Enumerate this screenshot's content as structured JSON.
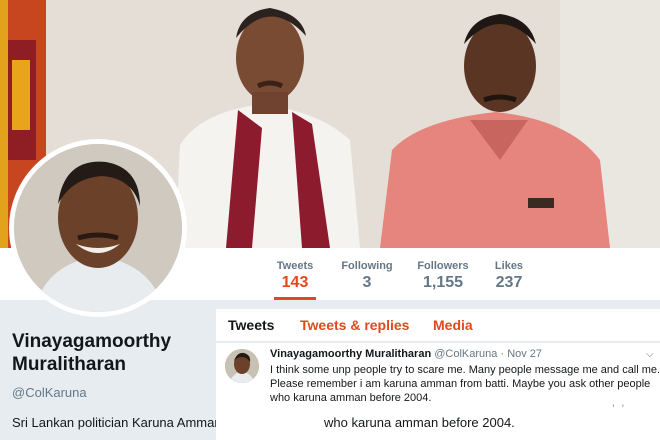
{
  "stats": [
    {
      "label": "Tweets",
      "value": "143",
      "active": true
    },
    {
      "label": "Following",
      "value": "3",
      "active": false
    },
    {
      "label": "Followers",
      "value": "1,155",
      "active": false
    },
    {
      "label": "Likes",
      "value": "237",
      "active": false
    }
  ],
  "profile": {
    "name_line1": "Vinayagamoorthy",
    "name_line2": "Muralitharan",
    "handle": "@ColKaruna",
    "bio": "Sri Lankan politician Karuna Amman"
  },
  "tabs": [
    {
      "label": "Tweets",
      "active": true
    },
    {
      "label": "Tweets & replies",
      "active": false
    },
    {
      "label": "Media",
      "active": false
    }
  ],
  "tweet": {
    "author": "Vinayagamoorthy Muralitharan",
    "handle": "@ColKaruna",
    "separator": "·",
    "date": "Nov 27",
    "lines": [
      "I think some unp people try to scare me. Many people message me and  call me.",
      "Please remember i am karuna amman from batti. Maybe you ask other people",
      "who karuna amman before 2004."
    ],
    "overflow_line": "who karuna amman before 2004."
  },
  "colors": {
    "accent": "#e0491d",
    "muted": "#657786",
    "panel": "#e6ecf0"
  },
  "icons": {
    "tweet_menu": "chevron-down-icon"
  }
}
